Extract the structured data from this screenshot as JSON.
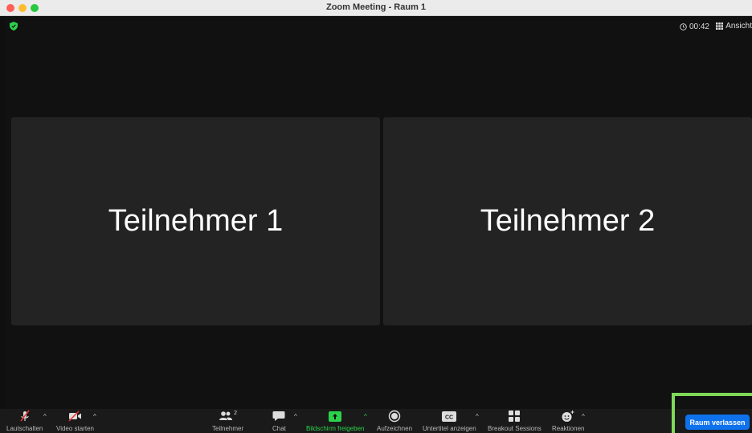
{
  "window": {
    "title": "Zoom Meeting - Raum 1"
  },
  "header": {
    "timer": "00:42",
    "view_label": "Ansicht"
  },
  "tiles": [
    {
      "name": "Teilnehmer 1"
    },
    {
      "name": "Teilnehmer 2"
    }
  ],
  "toolbar": {
    "mute_label": "Lautschalten",
    "video_label": "Video starten",
    "participants_label": "Teilnehmer",
    "participants_count": "2",
    "chat_label": "Chat",
    "share_label": "Bildschirm freigeben",
    "record_label": "Aufzeichnen",
    "cc_label": "Untertitel anzeigen",
    "breakout_label": "Breakout Sessions",
    "reactions_label": "Reaktionen",
    "leave_label": "Raum verlassen"
  },
  "colors": {
    "accent_green": "#2bd24b",
    "leave_blue": "#0e72ed",
    "highlight_frame": "#7ed957"
  }
}
